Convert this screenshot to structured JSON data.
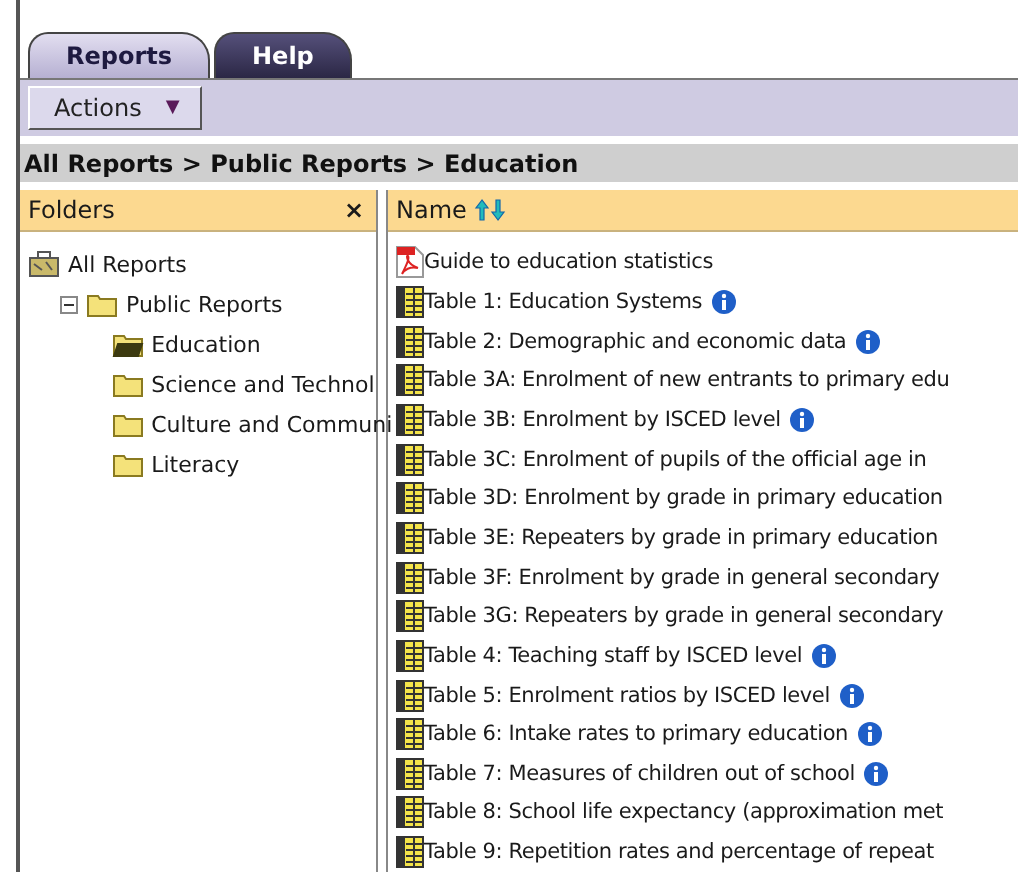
{
  "tabs": [
    {
      "label": "Reports",
      "selected": true
    },
    {
      "label": "Help",
      "selected": false
    }
  ],
  "toolbar": {
    "actions_label": "Actions",
    "actions_caret": "▼"
  },
  "breadcrumb": "All Reports > Public Reports > Education",
  "folders": {
    "title": "Folders",
    "close": "×",
    "tree": [
      {
        "label": "All Reports",
        "kind": "root",
        "children": [
          {
            "label": "Public Reports",
            "kind": "folder",
            "expanded": true,
            "selected": false,
            "children": [
              {
                "label": "Education",
                "kind": "folder",
                "selected": true
              },
              {
                "label": "Science and Technol",
                "kind": "folder",
                "selected": false
              },
              {
                "label": "Culture and Communi",
                "kind": "folder",
                "selected": false
              },
              {
                "label": "Literacy",
                "kind": "folder",
                "selected": false
              }
            ]
          }
        ]
      }
    ]
  },
  "list": {
    "column": "Name",
    "items": [
      {
        "kind": "pdf",
        "label": "Guide to education statistics",
        "info": false
      },
      {
        "kind": "table",
        "label": "Table 1: Education Systems",
        "info": true
      },
      {
        "kind": "table",
        "label": "Table 2: Demographic and economic data",
        "info": true
      },
      {
        "kind": "table",
        "label": "Table 3A: Enrolment of new entrants to primary edu",
        "info": false
      },
      {
        "kind": "table",
        "label": "Table 3B: Enrolment by ISCED level",
        "info": true
      },
      {
        "kind": "table",
        "label": "Table 3C: Enrolment of pupils of the official age in",
        "info": false
      },
      {
        "kind": "table",
        "label": "Table 3D: Enrolment by grade in primary education",
        "info": false
      },
      {
        "kind": "table",
        "label": "Table 3E: Repeaters by grade in primary education",
        "info": false
      },
      {
        "kind": "table",
        "label": "Table 3F: Enrolment by grade in general secondary",
        "info": false
      },
      {
        "kind": "table",
        "label": "Table 3G: Repeaters by grade in general secondary",
        "info": false
      },
      {
        "kind": "table",
        "label": "Table 4: Teaching staff by ISCED level",
        "info": true
      },
      {
        "kind": "table",
        "label": "Table 5: Enrolment ratios by ISCED level",
        "info": true
      },
      {
        "kind": "table",
        "label": "Table 6: Intake rates to primary education",
        "info": true
      },
      {
        "kind": "table",
        "label": "Table 7: Measures of children out of school",
        "info": true
      },
      {
        "kind": "table",
        "label": "Table 8: School life expectancy (approximation met",
        "info": false
      },
      {
        "kind": "table",
        "label": "Table 9: Repetition rates and percentage of repeat",
        "info": false
      }
    ]
  }
}
